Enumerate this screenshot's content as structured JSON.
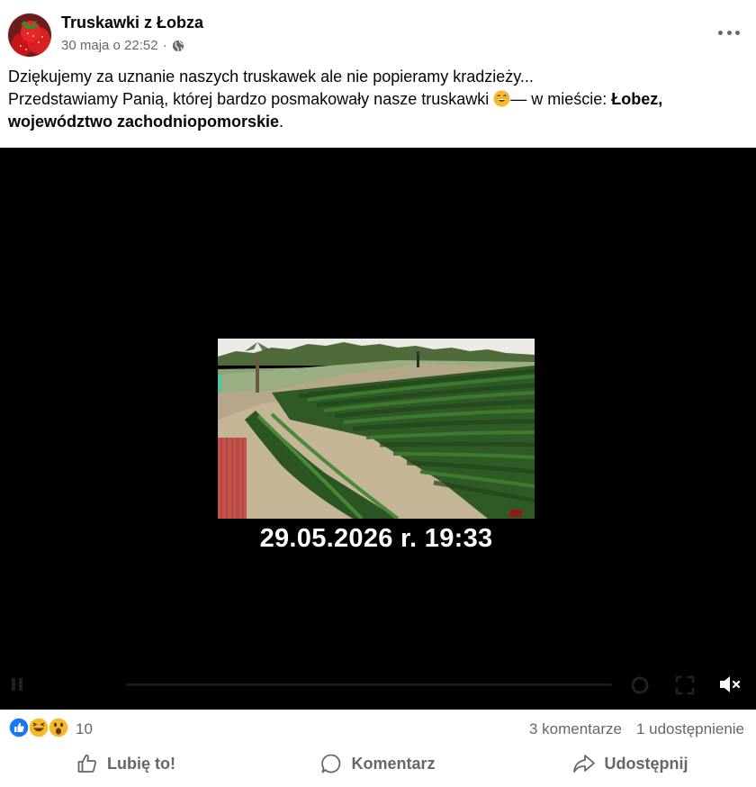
{
  "post": {
    "author": "Truskawki z Łobza",
    "date": "30 maja o 22:52",
    "separator": "·",
    "visibility_icon": "globe-icon",
    "more_icon": "more-icon",
    "text_line1": "Dziękujemy za uznanie naszych truskawek ale nie popieramy kradzieży...",
    "text_line2": "Przedstawiamy Panią, której bardzo posmakowały nasze truskawki",
    "emoji": "grinning-sweat-emoji",
    "location_prefix": "— w mieście:",
    "location": "Łobez, województwo zachodniopomorskie",
    "location_suffix": "."
  },
  "video": {
    "timestamp": "29.05.2026 r. 19:33",
    "muted": true,
    "mute_icon": "volume-muted-icon"
  },
  "stats": {
    "reactions": [
      "like",
      "haha",
      "wow"
    ],
    "reaction_count": "10",
    "comments": "3 komentarze",
    "shares": "1 udostępnienie"
  },
  "actions": {
    "like": "Lubię to!",
    "comment": "Komentarz",
    "share": "Udostępnij"
  },
  "colors": {
    "secondary_text": "#65676b",
    "like_blue": "#1877f2",
    "reaction_yellow": "#f7b928"
  }
}
